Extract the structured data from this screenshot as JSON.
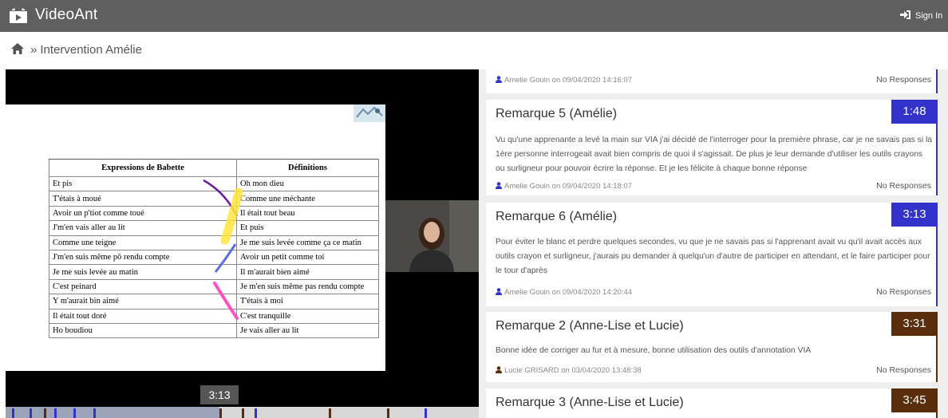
{
  "app": {
    "brand": "VideoAnt",
    "signin_label": "Sign In",
    "colors": {
      "topbar": "#5f5f5f",
      "blue": "#3333cc",
      "brown": "#5a2e0c",
      "timeline": "#d8d8d8"
    }
  },
  "breadcrumb": {
    "home_icon": "home-icon",
    "separator": "»",
    "title": "Intervention Amélie"
  },
  "video": {
    "current_time": "3:13",
    "table": {
      "headers": [
        "Expressions de Babette",
        "Définitions"
      ],
      "rows": [
        [
          "Et pis",
          "Oh mon dieu"
        ],
        [
          "T'étais à moué",
          "Comme une méchante"
        ],
        [
          "Avoir un p'tiot comme toué",
          "Il était tout beau"
        ],
        [
          "J'm'en vais aller au lit",
          "Et puis"
        ],
        [
          "Comme une teigne",
          "Je me suis levée comme ça ce matin"
        ],
        [
          "J'm'en suis même pô rendu compte",
          "Avoir un petit comme toi"
        ],
        [
          "Je me suis levée au matin",
          "Il m'aurait bien aimé"
        ],
        [
          "C'est peinard",
          "Je m'en suis même pas rendu compte"
        ],
        [
          "Y m'aurait bin aimé",
          "T'étais à moi"
        ],
        [
          "Il était tout doré",
          "C'est tranquille"
        ],
        [
          "Ho boudiou",
          "Je vais aller au lit"
        ]
      ]
    },
    "timeline_marks": [
      {
        "color": "#3333cc"
      },
      {
        "color": "#3333cc"
      },
      {
        "color": "#5a2e0c"
      },
      {
        "color": "#3333cc"
      },
      {
        "color": "#3333cc"
      },
      {
        "color": "#3333cc"
      },
      {
        "color": "#5a2e0c"
      },
      {
        "color": "#5a2e0c"
      },
      {
        "color": "#3333cc"
      },
      {
        "color": "#5a2e0c"
      },
      {
        "color": "#5a2e0c"
      },
      {
        "color": "#3333cc"
      }
    ]
  },
  "comments": [
    {
      "title": "",
      "time": "",
      "body": "",
      "author_line": "Amelie Gouin on 09/04/2020 14:16:07",
      "responses": "No Responses",
      "color": "#3333cc"
    },
    {
      "title": "Remarque 5 (Amélie)",
      "time": "1:48",
      "body": "Vu qu'une apprenante a levé la main sur VIA j'ai décidé de l'interroger pour la première phrase, car je ne savais pas si la 1ère personne interrogeait avait bien compris de quoi il s'agissait. De plus je leur demande d'utiliser les outils crayons ou surligneur pour pouvoir écrire la réponse. Et je les félicite à chaque bonne réponse",
      "author_line": "Amelie Gouin on 09/04/2020 14:18:07",
      "responses": "No Responses",
      "color": "#3333cc"
    },
    {
      "title": "Remarque 6 (Amélie)",
      "time": "3:13",
      "body": "Pour éviter le blanc et perdre quelques secondes, vu que je ne savais pas si l'apprenant avait vu qu'il avait accès aux outils crayon et surligneur, j'aurais pu demander à quelqu'un d'autre de participer en attendant, et le faire participer pour le tour d'après",
      "author_line": "Amelie Gouin on 09/04/2020 14:20:44",
      "responses": "No Responses",
      "color": "#3333cc"
    },
    {
      "title": "Remarque 2 (Anne-Lise et Lucie)",
      "time": "3:31",
      "body": "Bonne idée de corriger au fur et à mesure, bonne utilisation des outils d'annotation VIA",
      "author_line": "Lucie GRISARD on 03/04/2020 13:48:38",
      "responses": "No Responses",
      "color": "#5a2e0c"
    },
    {
      "title": "Remarque 3 (Anne-Lise et Lucie)",
      "time": "3:45",
      "body": "",
      "author_line": "",
      "responses": "",
      "color": "#5a2e0c"
    }
  ]
}
